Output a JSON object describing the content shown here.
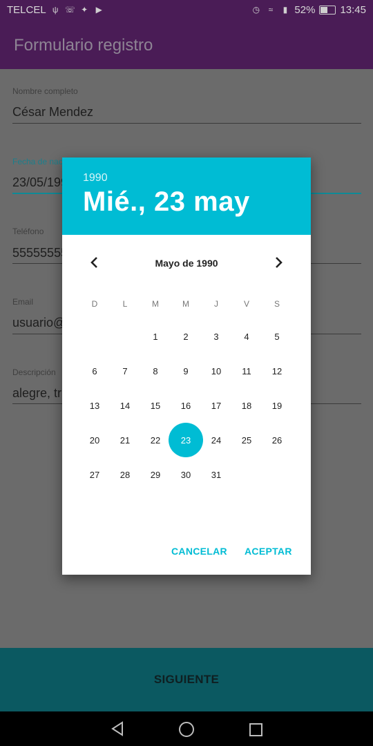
{
  "status_bar": {
    "carrier": "TELCEL",
    "battery_percent": "52%",
    "battery_level": 0.52,
    "time": "13:45",
    "icons": [
      "usb-icon",
      "whatsapp-icon",
      "twitter-icon",
      "youtube-icon",
      "alarm-icon",
      "wifi-icon",
      "signal-icon"
    ]
  },
  "app_bar": {
    "title": "Formulario registro"
  },
  "form": {
    "full_name": {
      "label": "Nombre completo",
      "value": "César Mendez"
    },
    "birth_date": {
      "label": "Fecha de nacimiento",
      "value": "23/05/1990"
    },
    "phone": {
      "label": "Teléfono",
      "value": "5555555555"
    },
    "email": {
      "label": "Email",
      "value": "usuario@"
    },
    "description": {
      "label": "Descripción",
      "value": "alegre, tr"
    }
  },
  "next_button": {
    "label": "SIGUIENTE"
  },
  "date_picker": {
    "year": "1990",
    "date_display": "Mié., 23 may",
    "month_title": "Mayo de 1990",
    "weekdays": [
      "D",
      "L",
      "M",
      "M",
      "J",
      "V",
      "S"
    ],
    "first_weekday_index": 2,
    "days_in_month": 31,
    "selected_day": 23,
    "cancel_label": "CANCELAR",
    "ok_label": "ACEPTAR",
    "accent_color": "#00bcd4"
  }
}
